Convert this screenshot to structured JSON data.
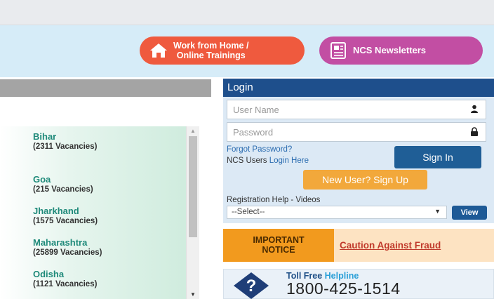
{
  "banner": {
    "work_from_home": "Work from Home /",
    "online_trainings": "Online Trainings",
    "newsletters": "NCS Newsletters"
  },
  "states": [
    {
      "name": "Bihar",
      "vacancies": "(2311 Vacancies)"
    },
    {
      "name": "Goa",
      "vacancies": "(215 Vacancies)"
    },
    {
      "name": "Jharkhand",
      "vacancies": "(1575 Vacancies)"
    },
    {
      "name": "Maharashtra",
      "vacancies": "(25899 Vacancies)"
    },
    {
      "name": "Odisha",
      "vacancies": "(1121 Vacancies)"
    }
  ],
  "login": {
    "title": "Login",
    "username_placeholder": "User Name",
    "password_placeholder": "Password",
    "forgot_password": "Forgot Password?",
    "ncs_users": "NCS Users",
    "login_here": "Login Here",
    "sign_in": "Sign In",
    "sign_up": "New User? Sign Up",
    "registration_help": "Registration Help - Videos",
    "select_value": "--Select--",
    "view": "View"
  },
  "notice": {
    "label_line1": "IMPORTANT",
    "label_line2": "NOTICE",
    "link": "Caution Against Fraud"
  },
  "helpline": {
    "toll_free": "Toll Free",
    "helpline": "Helpline",
    "number": "1800-425-1514"
  },
  "icons": [
    "house-icon",
    "newsletter-icon",
    "user-icon",
    "lock-icon",
    "question-icon",
    "chevron-down-icon"
  ]
}
